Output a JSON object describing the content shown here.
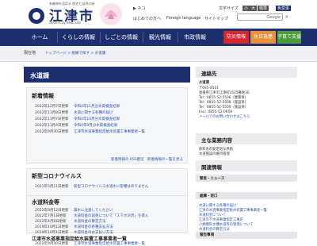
{
  "header": {
    "tagline": "有磯海を見はる 歴史と自然の街",
    "city_name": "江津市",
    "city_name_en": "Gotsu City Web Site",
    "util_top": [
      "▶ ネコ",
      "文字サイズ",
      "小",
      "大",
      "標準",
      "色変更"
    ],
    "util_links": [
      "はじめての方へ",
      "Foreign language",
      "サイトマップ"
    ],
    "search_placeholder": "",
    "search_engine": "Google"
  },
  "gnav": {
    "items": [
      "ホーム",
      "くらしの情報",
      "しごとの情報",
      "観光情報",
      "市政情報"
    ],
    "buttons": [
      {
        "label": "防災情報",
        "color": "#d8252e"
      },
      {
        "label": "休日急患",
        "color": "#e8913a"
      },
      {
        "label": "子育て支援",
        "color": "#4a9c3c"
      }
    ]
  },
  "breadcrumb": {
    "home": "現在地",
    "path": "トップページ > 組織で探す > 水道課"
  },
  "main": {
    "title": "水道課",
    "news": {
      "heading": "新着情報",
      "items": [
        {
          "date": "2022年12月7日更新",
          "text": "令和4年11月分水質検査結果"
        },
        {
          "date": "2022年11月8日更新",
          "text": "水道に関する各種の届け"
        },
        {
          "date": "2022年11月7日更新",
          "text": "令和4年10月分水質検査結果"
        },
        {
          "date": "2022年11月4日更新",
          "text": "令和4年9月分水質検査結果"
        },
        {
          "date": "2022年9月30日更新",
          "text": "江津市水道事業指定給水装置工事事業者一覧"
        }
      ],
      "rss": "新着情報の RSS配信",
      "more": "新着情報の一覧を見る"
    },
    "corona": {
      "heading": "新型コロナウイルス",
      "items": [
        {
          "date": "2021年5月11日更新",
          "text": "新型コロナウイルス水道水に影響はありません"
        }
      ]
    },
    "water": {
      "heading": "水道料金等",
      "items": [
        {
          "date": "2022年9月12日更新",
          "text": "漏水に注意してください"
        },
        {
          "date": "2022年7月1日更新",
          "text": "水道料金の減免について「スマホ決済」を導入"
        },
        {
          "date": "2022年4月8日更新",
          "text": "水道料金の算定方法"
        },
        {
          "date": "2019年10月1日更新",
          "text": "水道料金の各種支払方法"
        },
        {
          "date": "2019年10月1日更新",
          "text": "水道料金のお支払い方法"
        }
      ]
    },
    "contractor": {
      "heading": "江津市水道事業指定給水装置工事事業者一覧",
      "items": [
        {
          "date": "2022年9月30日更新",
          "text": "江津市水道事業指定給水装置工事事業者一覧"
        }
      ]
    }
  },
  "right": {
    "contact_heading": "連絡先",
    "contact_lines": [
      "水道課",
      "〒695-8501",
      "島根県江津市江津町1525番地30",
      "Tel：0855-52-5506（業務係）",
      "Tel：0855-52-5508（施設係）",
      "Tel：0855-52-5509（施設係）",
      "Fax：0855-52-0659"
    ],
    "contact_link": "メールでのお問い合わせはこちら",
    "duties_heading": "主な業務内容",
    "duties": [
      "飲料水の安定的な供給",
      "水道施設の維持管理"
    ],
    "related_heading": "関連情報",
    "related_sub1": "緊急・ニュース",
    "related_sub2": "組織・窓口",
    "related_links": [
      "水道に関する各種の届け",
      "江津市水道事業指定給水装置工事事業者一覧",
      "水道料金について",
      "江津市下水道事業指定工事店",
      "小規模貯水槽水道等の管理について",
      "水道料金の算定方法"
    ],
    "related_sub3": "報告事項"
  }
}
